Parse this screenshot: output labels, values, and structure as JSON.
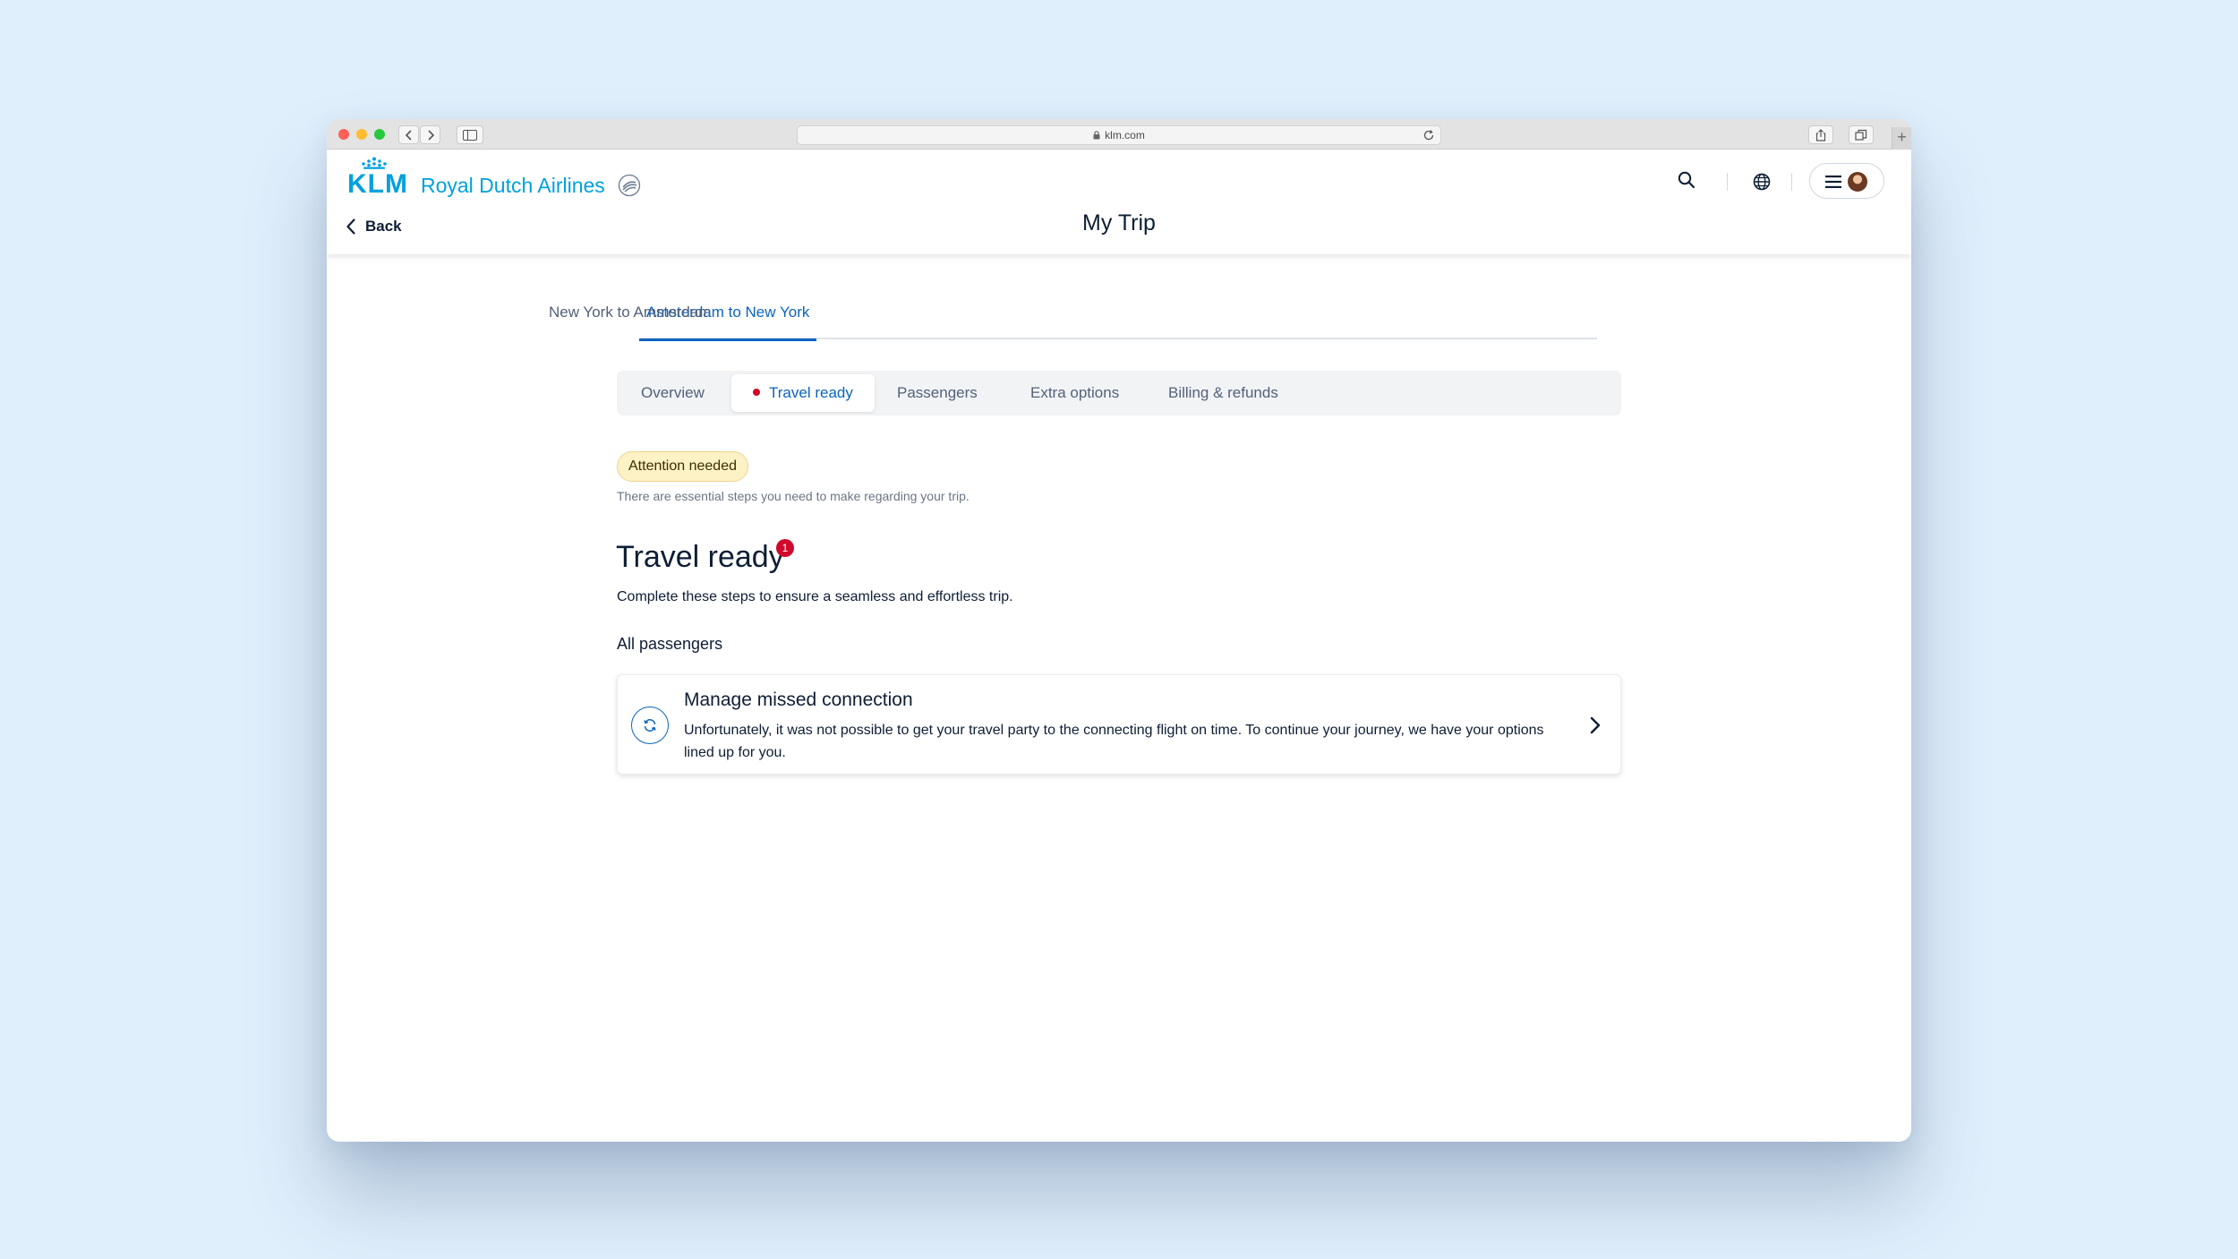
{
  "browser": {
    "url": "klm.com"
  },
  "header": {
    "brand_word": "KLM",
    "brand_name": "Royal Dutch Airlines",
    "back_label": "Back",
    "page_title": "My Trip"
  },
  "route_tabs": [
    {
      "label": "Amsterdam to New York",
      "active": true
    },
    {
      "label": "New York to Amsterdam",
      "active": false
    }
  ],
  "section_tabs": [
    {
      "label": "Overview"
    },
    {
      "label": "Travel ready",
      "active": true
    },
    {
      "label": "Passengers"
    },
    {
      "label": "Extra options"
    },
    {
      "label": "Billing & refunds"
    }
  ],
  "status": {
    "badge": "Attention needed",
    "description": "There are essential steps you need to make regarding your trip."
  },
  "travel_ready": {
    "title": "Travel ready",
    "count": "1",
    "lead": "Complete these steps to ensure a seamless and effortless trip.",
    "group_label": "All passengers"
  },
  "task_card": {
    "title": "Manage missed connection",
    "text": "Unfortunately, it was not possible to get your travel party to the connecting flight on time. To continue your journey, we have your options lined up for you."
  },
  "colors": {
    "brand": "#00a1de",
    "accent": "#0b64c0",
    "alert": "#cf0a2c",
    "attention_bg": "#fdf1c6"
  }
}
